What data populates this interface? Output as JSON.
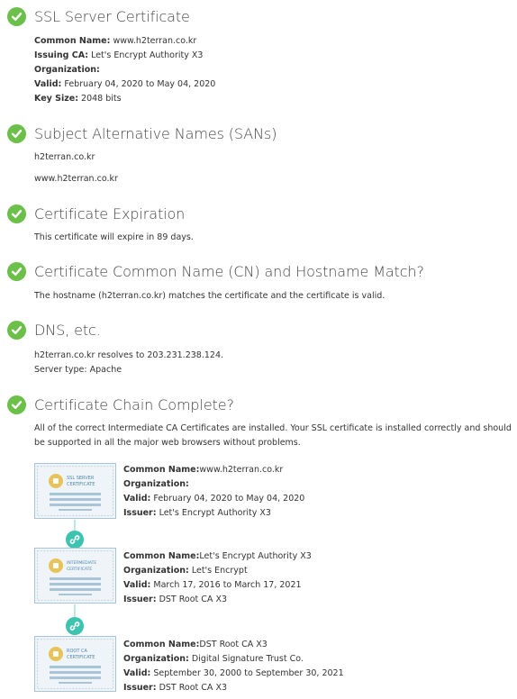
{
  "sections": {
    "ssl": {
      "title": "SSL Server Certificate",
      "common_name_label": "Common Name:",
      "common_name": "www.h2terran.co.kr",
      "issuing_ca_label": "Issuing CA:",
      "issuing_ca": "Let's Encrypt Authority X3",
      "organization_label": "Organization:",
      "valid_label": "Valid:",
      "valid": "February 04, 2020 to May 04, 2020",
      "key_size_label": "Key Size:",
      "key_size": "2048 bits"
    },
    "sans": {
      "title": "Subject Alternative Names (SANs)",
      "items": [
        "h2terran.co.kr",
        "www.h2terran.co.kr"
      ]
    },
    "expiration": {
      "title": "Certificate Expiration",
      "text": "This certificate will expire in 89 days."
    },
    "hostname": {
      "title": "Certificate Common Name (CN) and Hostname Match?",
      "text": "The hostname (h2terran.co.kr) matches the certificate and the certificate is valid."
    },
    "dns": {
      "title": "DNS, etc.",
      "resolves": "h2terran.co.kr resolves to 203.231.238.124.",
      "server_type": "Server type: Apache"
    },
    "chain": {
      "title": "Certificate Chain Complete?",
      "text": "All of the correct Intermediate CA Certificates are installed. Your SSL certificate is installed correctly and should be supported in all the major web browsers without problems.",
      "certs": [
        {
          "badge_line1": "SSL SERVER",
          "badge_line2": "CERTIFICATE",
          "common_name_label": "Common Name:",
          "common_name": "www.h2terran.co.kr",
          "organization_label": "Organization:",
          "organization": "",
          "valid_label": "Valid:",
          "valid": "February 04, 2020 to May 04, 2020",
          "issuer_label": "Issuer:",
          "issuer": "Let's Encrypt Authority X3"
        },
        {
          "badge_line1": "INTERMEDIATE",
          "badge_line2": "CERTIFICATE",
          "common_name_label": "Common Name:",
          "common_name": "Let's Encrypt Authority X3",
          "organization_label": "Organization:",
          "organization": "Let's Encrypt",
          "valid_label": "Valid:",
          "valid": "March 17, 2016 to March 17, 2021",
          "issuer_label": "Issuer:",
          "issuer": "DST Root CA X3"
        },
        {
          "badge_line1": "ROOT CA",
          "badge_line2": "CERTIFICATE",
          "common_name_label": "Common Name:",
          "common_name": "DST Root CA X3",
          "organization_label": "Organization:",
          "organization": "Digital Signature Trust Co.",
          "valid_label": "Valid:",
          "valid": "September 30, 2000 to September 30, 2021",
          "issuer_label": "Issuer:",
          "issuer": "DST Root CA X3"
        }
      ]
    }
  },
  "colors": {
    "check_green": "#6cc04a",
    "link_teal": "#3cc4b0",
    "cert_border": "#a9c4d6",
    "cert_bg": "#eef4f8",
    "seal_gold": "#e8c35a"
  },
  "icons": {
    "section_status": "check-circle-icon",
    "chain_link": "link-icon",
    "certificate": "certificate-icon"
  }
}
